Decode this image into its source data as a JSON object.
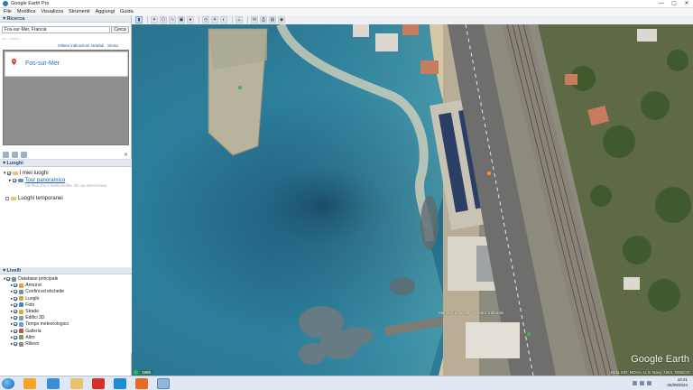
{
  "window": {
    "title": "Google Earth Pro",
    "controls": [
      "—",
      "▢",
      "✕"
    ]
  },
  "menu": [
    "File",
    "Modifica",
    "Visualizza",
    "Strumenti",
    "Aggiungi",
    "Guida"
  ],
  "search": {
    "header": "Ricerca",
    "value": "Fos-sur-Mer, Francia",
    "button": "Cerca",
    "hint": "es.: 94043",
    "route_link": "Ottieni indicazioni stradali",
    "history_link": "Storia",
    "result": "Fos-sur-Mer"
  },
  "places": {
    "header": "Luoghi",
    "items": [
      {
        "label": "I miei luoghi"
      },
      {
        "label": "Tour panoramico"
      },
      {
        "label": "Verifica che il livello Edifici 3D sia selezionato"
      },
      {
        "label": "Luoghi temporanei"
      }
    ]
  },
  "layers": {
    "header": "Livelli",
    "items": [
      {
        "label": "Database principale",
        "color": "#7a8a9c"
      },
      {
        "label": "Annunci",
        "color": "#e0a33a"
      },
      {
        "label": "Confini ed etichette",
        "color": "#7a8fb0"
      },
      {
        "label": "Luoghi",
        "color": "#c9a84a"
      },
      {
        "label": "Foto",
        "color": "#4a86c6"
      },
      {
        "label": "Strade",
        "color": "#d0b040"
      },
      {
        "label": "Edifici 3D",
        "color": "#8a9aaa"
      },
      {
        "label": "Tempo meteorologico",
        "color": "#6aa0d0"
      },
      {
        "label": "Galleria",
        "color": "#c0504d"
      },
      {
        "label": "Altro",
        "color": "#7b9c5a"
      },
      {
        "label": "Rilievo",
        "color": "#8c8c8c"
      }
    ]
  },
  "map": {
    "watermark": "Google Earth",
    "imagery_year": "1985",
    "footer": "Data SIO, NOAA, U.S. Navy, NGA, GEBCO",
    "labels": [
      "Mercure Lavoisier - Centro Culturale"
    ]
  },
  "taskbar": {
    "time": "10:21",
    "date": "06/09/2024"
  }
}
